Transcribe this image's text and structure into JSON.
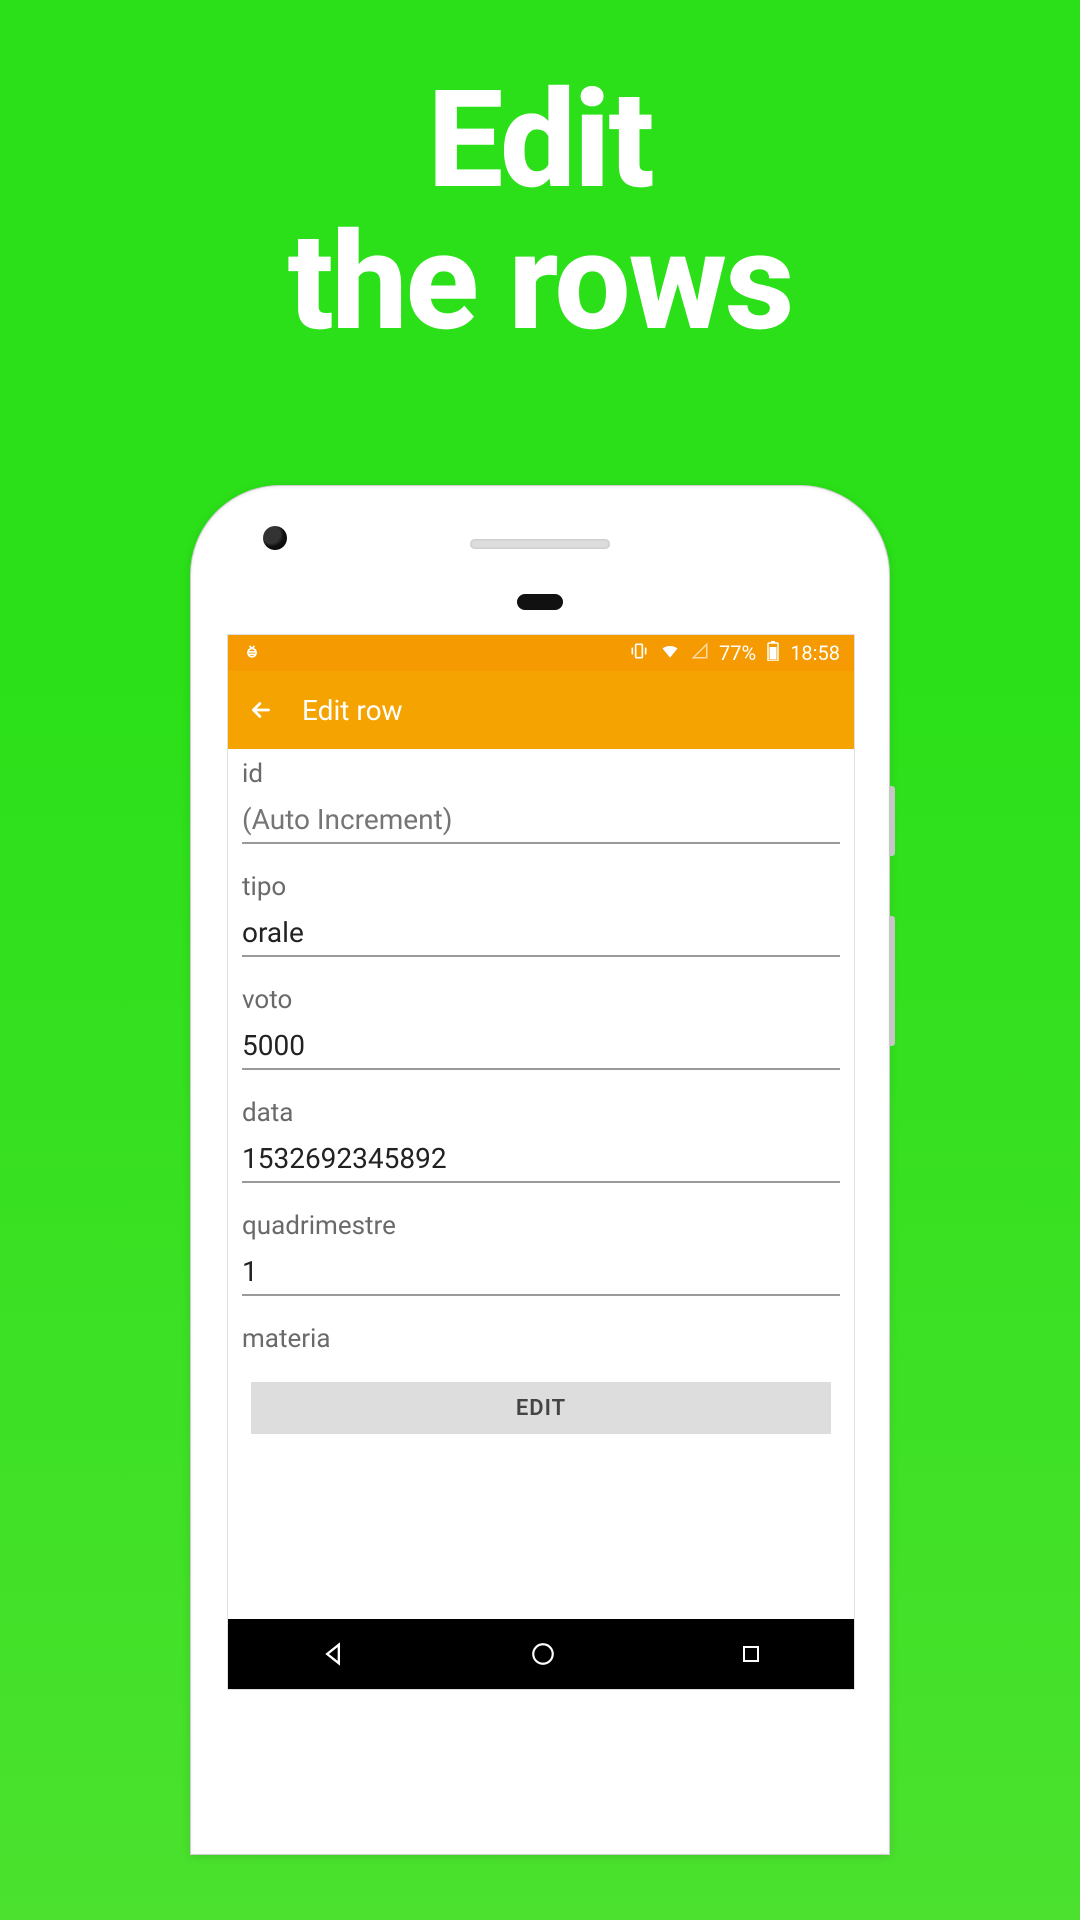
{
  "hero": {
    "line1": "Edit",
    "line2": "the rows"
  },
  "statusbar": {
    "battery_text": "77%",
    "time": "18:58"
  },
  "appbar": {
    "title": "Edit row"
  },
  "fields": {
    "id": {
      "label": "id",
      "placeholder": "(Auto Increment)",
      "value": ""
    },
    "tipo": {
      "label": "tipo",
      "value": "orale"
    },
    "voto": {
      "label": "voto",
      "value": "5000"
    },
    "data": {
      "label": "data",
      "value": "1532692345892"
    },
    "quad": {
      "label": "quadrimestre",
      "value": "1"
    },
    "materia": {
      "label": "materia"
    }
  },
  "edit_button": {
    "label": "EDIT"
  },
  "colors": {
    "accent": "#f5a300",
    "bg": "#2be019"
  }
}
